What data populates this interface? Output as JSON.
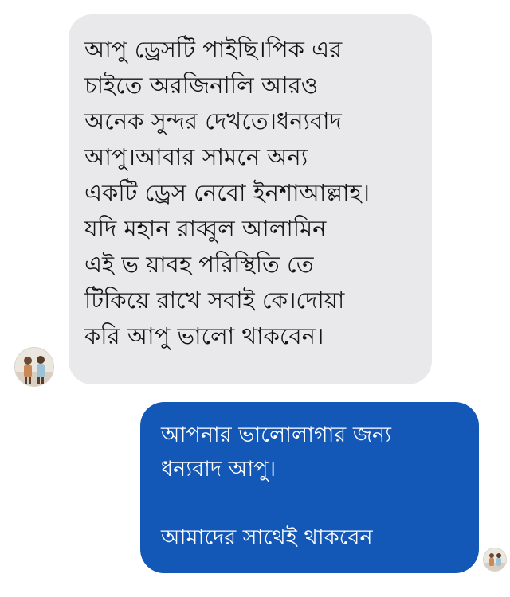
{
  "conversation": {
    "incoming": {
      "lines": [
        "আপু ড্রেসটি পাইছি।পিক এর",
        "চাইতে অরজিনালি আরও",
        "অনেক সুন্দর দেখতে।ধন্যবাদ",
        "আপু।আবার সামনে অন্য",
        "একটি ড্রেস নেবো ইনশাআল্লাহ।",
        "যদি মহান  রাব্বুল  আলামিন",
        "এই ভ য়াবহ পরিস্থিতি তে",
        "টিকিয়ে রাখে সবাই কে।দোয়া",
        "করি আপু ভালো থাকবেন।"
      ]
    },
    "outgoing": {
      "lines": [
        "আপনার ভালোলাগার জন্য",
        "ধন্যবাদ আপু।",
        "",
        "আমাদের সাথেই থাকবেন"
      ]
    },
    "colors": {
      "incoming_bubble": "#e9e9eb",
      "outgoing_bubble": "#1357b7",
      "incoming_text": "#141414",
      "outgoing_text": "#ffffff"
    }
  }
}
